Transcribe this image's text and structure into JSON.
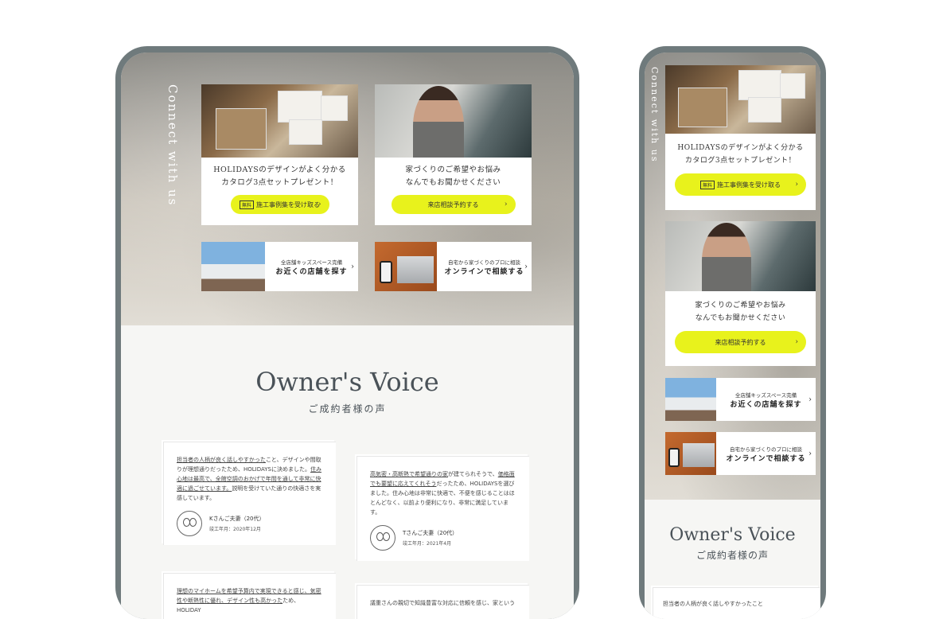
{
  "connect_label": "Connect with us",
  "catalog_card": {
    "line1": "HOLIDAYSのデザインがよく分かる",
    "line2": "カタログ3点セットプレゼント！",
    "tag": "無料",
    "button": "施工事例集を受け取る",
    "arrow": "›"
  },
  "consult_card": {
    "line1": "家づくりのご希望やお悩み",
    "line2": "なんでもお聞かせください",
    "button": "来店相談予約する",
    "arrow": "›"
  },
  "store_link": {
    "small": "全店舗キッズスペース完備",
    "big": "お近くの店舗を探す",
    "arrow": "›"
  },
  "online_link": {
    "small": "自宅から家づくりのプロに相談",
    "big": "オンラインで相談する",
    "arrow": "›"
  },
  "voice": {
    "title": "Owner's Voice",
    "subtitle": "ご成約者様の声"
  },
  "testimonials": [
    {
      "text_underlined_1": "担当者の人柄が良く話しやすかった",
      "text_1": "こと、デザインや間取りが理想通りだったため、HOLIDAYSに決めました。",
      "text_underlined_2": "住み心地は最高で、全館空調のおかげで年間を通して非常に快適に過ごせています。",
      "text_2": "説明を受けていた通りの快適さを実感しています。",
      "name": "Kさんご夫妻（20代）",
      "date": "竣工年月：2020年12月"
    },
    {
      "text_underlined_1": "高気密・高断熱で希望通りの家",
      "text_1": "が建てられそうで、",
      "text_underlined_2": "価格面でも要望に応えてくれそう",
      "text_2": "だったため、HOLIDAYSを選びました。住み心地は非常に快適で、不便を感じることはほとんどなく、以前より便利になり、非常に満足しています。",
      "name": "Tさんご夫妻（20代）",
      "date": "竣工年月：2021年4月"
    },
    {
      "text_underlined_1": "理想のマイホームを希望予算内で実現できると感じ、気密性や断熱性に優れ、デザイン性も高かった",
      "text_1": "ため、HOLIDAY"
    },
    {
      "text_1": "議重さんの親切で知識豊富な対応に信頼を感じ、家という"
    }
  ],
  "phone_partial_text": "担当者の人柄が良く話しやすかったこと"
}
